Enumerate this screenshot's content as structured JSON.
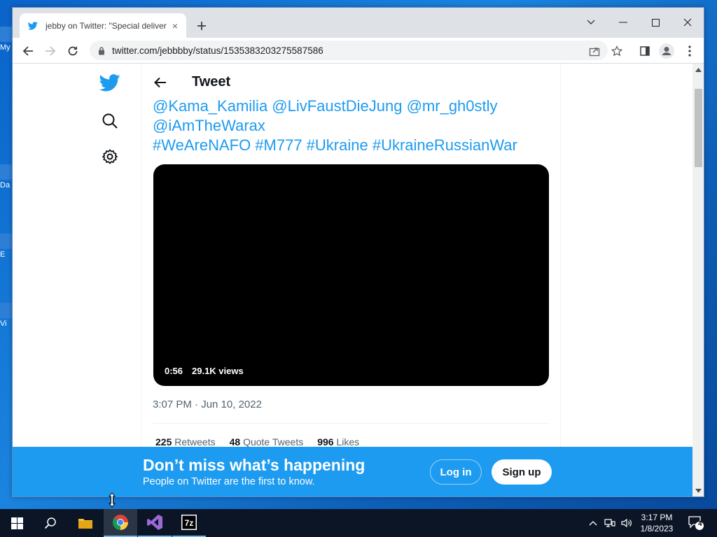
{
  "desktop": {
    "icons": [
      "My",
      "Da",
      "E",
      "Vi"
    ]
  },
  "browser": {
    "tab": {
      "title": "jebby on Twitter: \"Special deliver",
      "close": "×"
    },
    "url": "twitter.com/jebbbby/status/1535383203275587586"
  },
  "tweet": {
    "header": "Tweet",
    "text_lines": [
      "@Kama_Kamilia @LivFaustDieJung @mr_gh0stly",
      "@iAmTheWarax",
      "#WeAreNAFO #M777 #Ukraine #UkraineRussianWar"
    ],
    "media": {
      "duration": "0:56",
      "views": "29.1K views"
    },
    "timestamp": "3:07 PM · Jun 10, 2022",
    "stats": {
      "retweets_count": "225",
      "retweets_label": "Retweets",
      "quotes_count": "48",
      "quotes_label": "Quote Tweets",
      "likes_count": "996",
      "likes_label": "Likes"
    }
  },
  "banner": {
    "title": "Don’t miss what’s happening",
    "subtitle": "People on Twitter are the first to know.",
    "login": "Log in",
    "signup": "Sign up"
  },
  "taskbar": {
    "time": "3:17 PM",
    "date": "1/8/2023",
    "notifications": "4"
  },
  "colors": {
    "twitter_blue": "#1d9bf0",
    "text_gray": "#536471"
  }
}
